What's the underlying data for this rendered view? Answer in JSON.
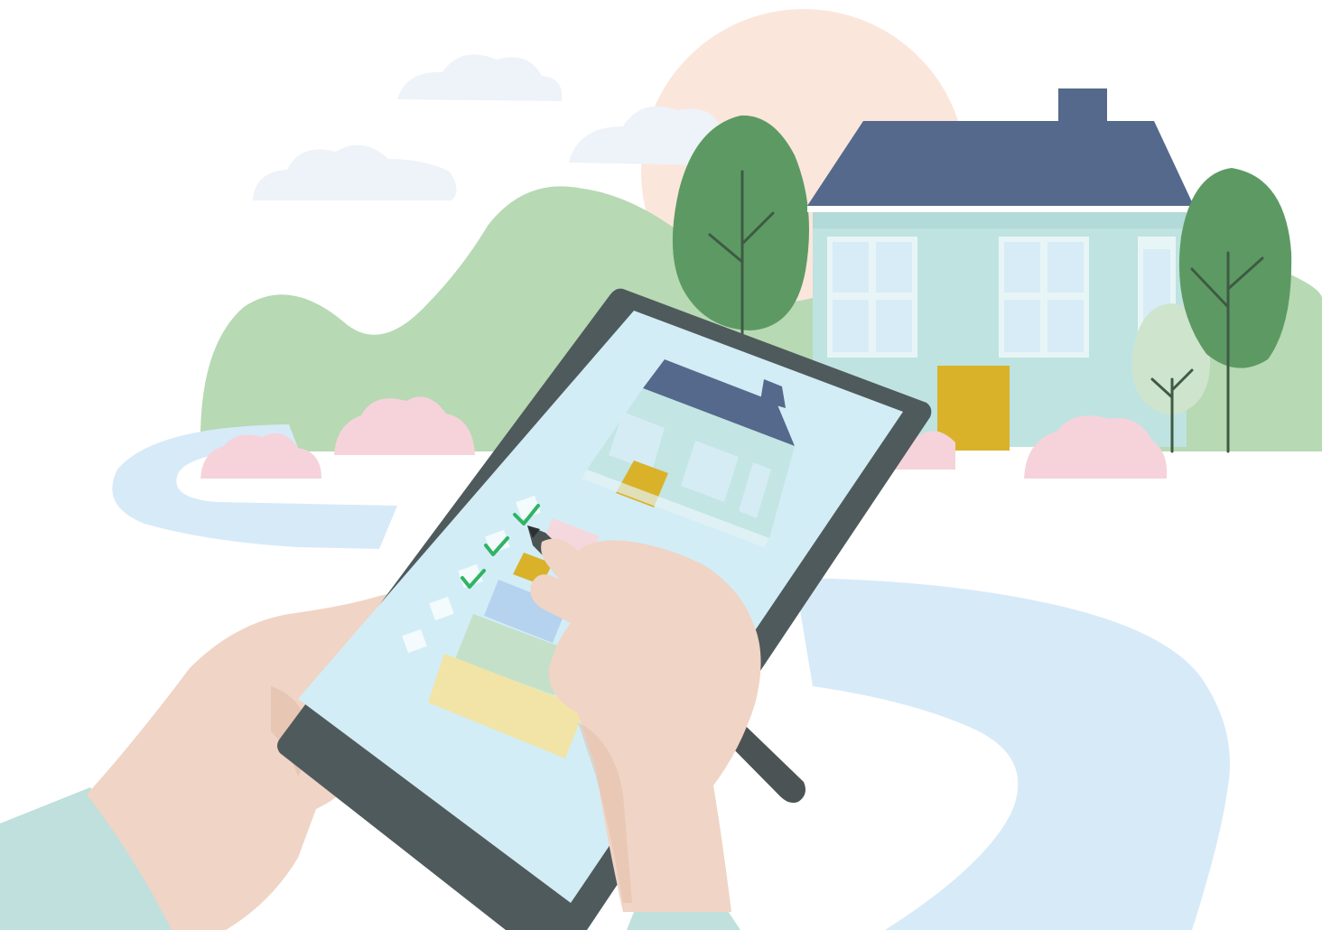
{
  "scene": {
    "subject": "hands-writing-checklist-on-tablet-in-front-of-house",
    "checklist": {
      "checked_items": 3,
      "total_items": 5
    },
    "colors": {
      "background": "#ffffff",
      "sun": "#fbe6dc",
      "cloud": "#edf3f8",
      "hill": "#b7d9b4",
      "tree_dark": "#5d9a63",
      "tree_light": "#cfe4cd",
      "trunk": "#3f5a45",
      "roof": "#54698b",
      "house_wall": "#bfe3e0",
      "house_wall_shade": "#a9d4d2",
      "window_pane": "#d7ecf6",
      "window_frame": "#e8f5f6",
      "door": "#dab22a",
      "bush": "#f6d3da",
      "path": "#d7eaf8",
      "tablet_body": "#4f5a5c",
      "tablet_screen": "#d3edf6",
      "check_green": "#2fb463",
      "bar_blue": "#b5d2ee",
      "bar_green": "#c5e0c9",
      "bar_yellow": "#f2e4a6",
      "skin": "#f0d4c5",
      "skin_shade": "#e2bca8",
      "sleeve": "#bfe0dd",
      "stylus": "#4b5355"
    },
    "icons": [
      "sun-shape",
      "cloud-shape",
      "hill-shape",
      "tree-shape",
      "house-shape",
      "bush-shape",
      "path-shape",
      "tablet-shape",
      "check-icon",
      "checkbox-icon",
      "hand-shape",
      "stylus-shape"
    ]
  }
}
